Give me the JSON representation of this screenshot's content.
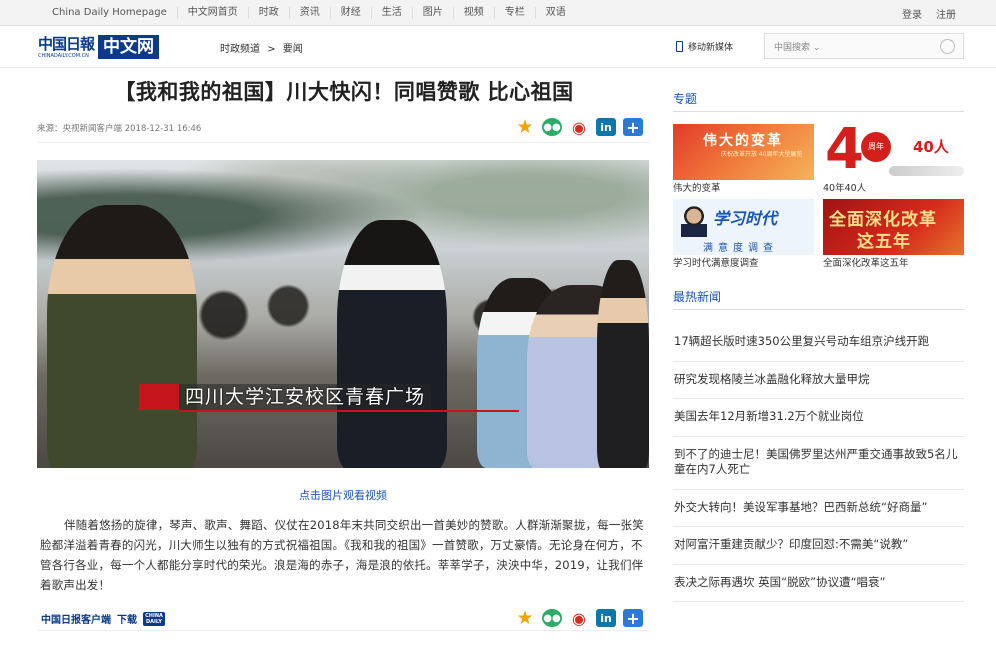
{
  "topnav": {
    "links": [
      "China Daily Homepage",
      "中文网首页",
      "时政",
      "资讯",
      "财经",
      "生活",
      "图片",
      "视频",
      "专栏",
      "双语"
    ],
    "login": "登录",
    "register": "注册"
  },
  "header": {
    "logo_text": "中国日報",
    "logo_sub": "CHINADAILY.COM.CN",
    "logo_tag": "中文网",
    "breadcrumb": [
      "时政频道",
      "要闻"
    ],
    "breadcrumb_sep": ">",
    "mobile_label": "移动新媒体",
    "search_placeholder": "中国搜索 ⌄"
  },
  "article": {
    "title": "【我和我的祖国】川大快闪！同唱赞歌 比心祖国",
    "source": "来源：央视新闻客户端",
    "datetime": "2018-12-31 16:46",
    "image_caption": "四川大学江安校区青春广场",
    "video_link": "点击图片观看视频",
    "body": "伴随着悠扬的旋律，琴声、歌声、舞蹈、仪仗在2018年末共同交织出一首美妙的赞歌。人群渐渐聚拢，每一张笑脸都洋溢着青春的闪光，川大师生以独有的方式祝福祖国。《我和我的祖国》一首赞歌，万丈豪情。无论身在何方，不管各行各业，每一个人都能分享时代的荣光。浪是海的赤子，海是浪的依托。莘莘学子，泱泱中华，2019，让我们伴着歌声出发！",
    "app_label": "中国日报客户端",
    "download_label": "下载",
    "app_badge": "CHINA DAILY"
  },
  "share": {
    "linkedin": "in",
    "plus": "+"
  },
  "sidebar": {
    "topics_heading": "专题",
    "topics": [
      {
        "label": "伟大的变革",
        "img_line1": "伟大的变革",
        "img_line2": "庆祝改革开放 40周年大型展览"
      },
      {
        "label": "40年40人",
        "img_big": "4",
        "img_ring": "周年",
        "img_side": "40人"
      },
      {
        "label": "学习时代满意度调查",
        "img_line1": "学习时代",
        "img_line2": "满意度调查"
      },
      {
        "label": "全面深化改革这五年",
        "img_line1": "全面深化改革",
        "img_line2": "这五年"
      }
    ],
    "hot_heading": "最热新闻",
    "hot_news": [
      "17辆超长版时速350公里复兴号动车组京沪线开跑",
      "研究发现格陵兰冰盖融化释放大量甲烷",
      "美国去年12月新增31.2万个就业岗位",
      "到不了的迪士尼！美国佛罗里达州严重交通事故致5名儿童在内7人死亡",
      "外交大转向！美设军事基地？巴西新总统“好商量”",
      "对阿富汗重建贡献少？印度回怼:不需美“说教”",
      "表决之际再遇坎 英国“脱欧”协议遭“唱衰”"
    ]
  }
}
